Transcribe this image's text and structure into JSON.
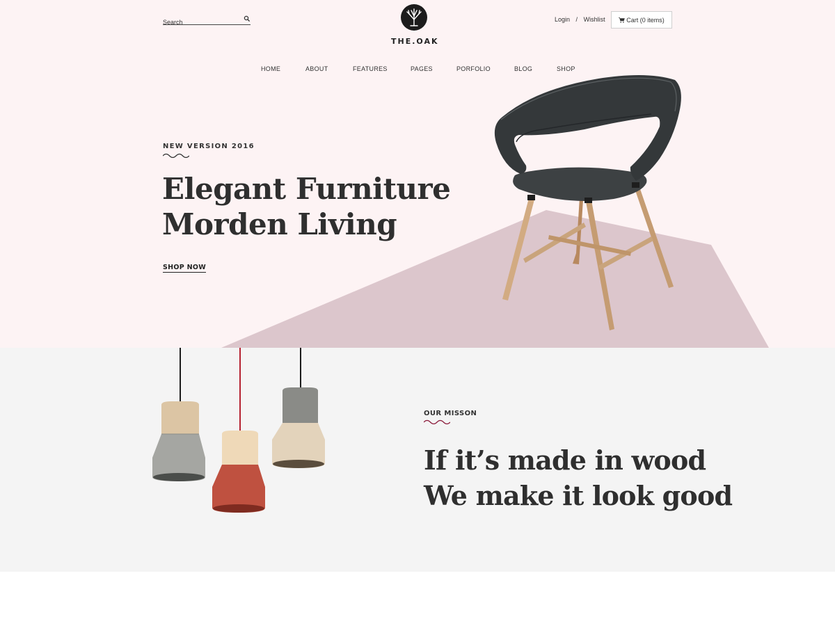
{
  "header": {
    "search_placeholder": "Search",
    "search_icon": "search-icon",
    "logo_icon": "tree-icon",
    "logo_text": "THE.OAK",
    "login_label": "Login",
    "separator": "/",
    "wishlist_label": "Wishlist",
    "cart_icon": "cart-icon",
    "cart_label": "Cart (0 items)"
  },
  "nav": {
    "items": [
      "HOME",
      "ABOUT",
      "FEATURES",
      "PAGES",
      "PORFOLIO",
      "BLOG",
      "SHOP"
    ]
  },
  "hero": {
    "eyebrow": "NEW VERSION 2016",
    "headline_line1": "Elegant Furniture",
    "headline_line2": "Morden Living",
    "cta_label": "SHOP NOW"
  },
  "mission": {
    "eyebrow": "OUR MISSON",
    "headline_line1": "If it’s made in wood",
    "headline_line2": "We make it look good"
  },
  "colors": {
    "hero_bg": "#fdf3f4",
    "floor": "#dcc6cc",
    "mission_bg": "#f4f4f4",
    "accent_squiggle": "#8b1a3a",
    "text_dark": "#2f2f2f"
  }
}
